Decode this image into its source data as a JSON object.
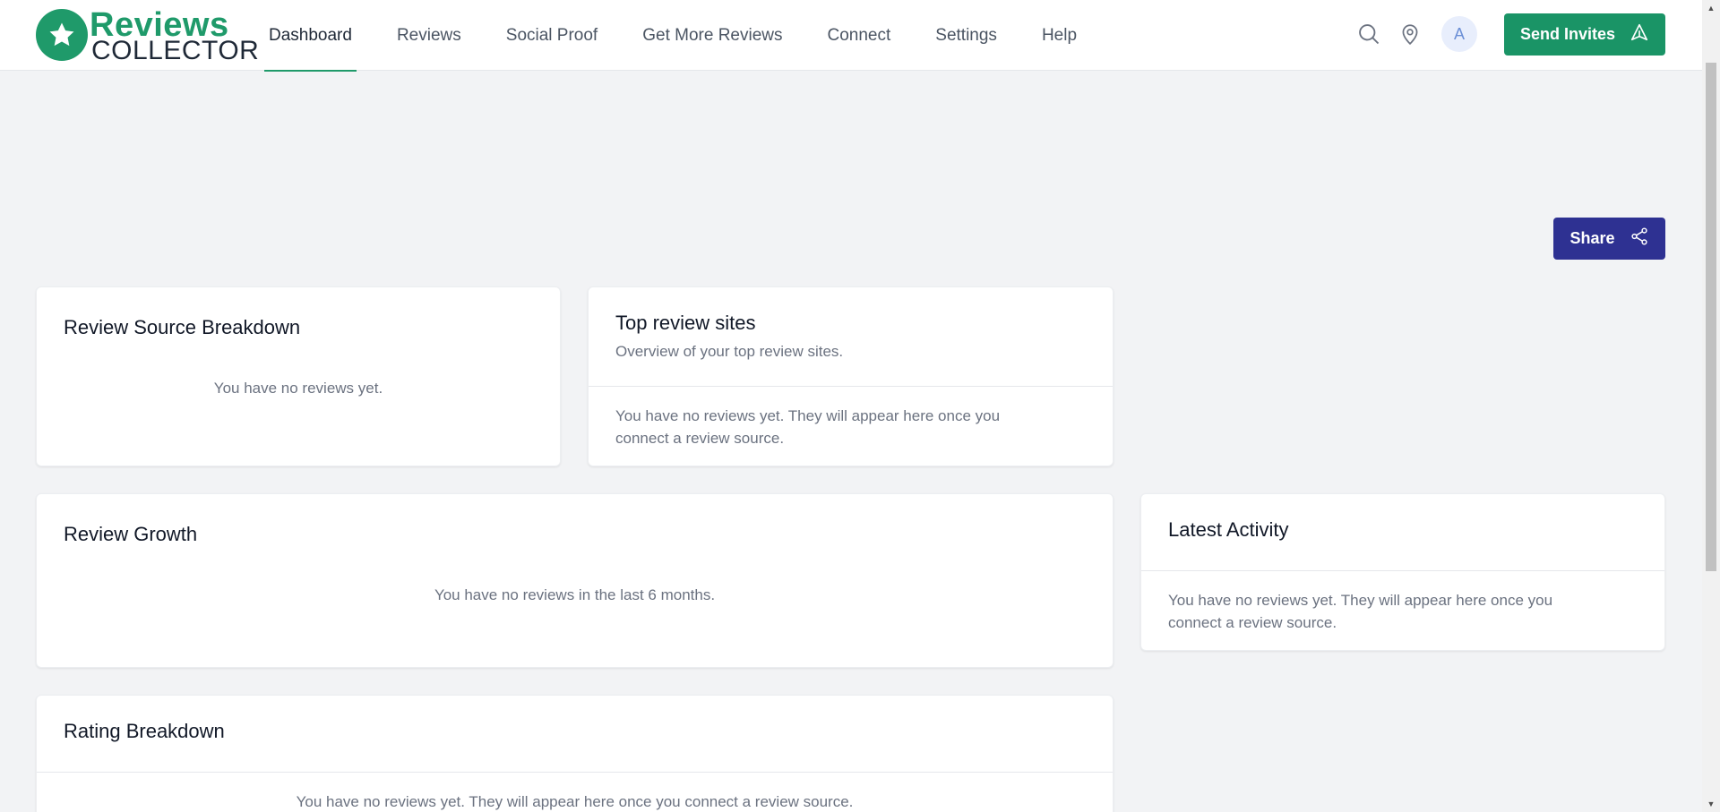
{
  "header": {
    "logo_line1": "Reviews",
    "logo_line2": "COLLECTOR",
    "nav": [
      {
        "label": "Dashboard",
        "active": true
      },
      {
        "label": "Reviews"
      },
      {
        "label": "Social Proof"
      },
      {
        "label": "Get More Reviews"
      },
      {
        "label": "Connect"
      },
      {
        "label": "Settings"
      },
      {
        "label": "Help"
      }
    ],
    "avatar_initial": "A",
    "send_invites_label": "Send Invites",
    "icons": [
      "search-icon",
      "location-pin-icon",
      "send-icon"
    ]
  },
  "toolbar": {
    "share_label": "Share"
  },
  "cards": {
    "review_source": {
      "title": "Review Source Breakdown",
      "empty": "You have no reviews yet."
    },
    "top_sites": {
      "title": "Top review sites",
      "subtitle": "Overview of your top review sites.",
      "empty_line1": "You have no reviews yet. They will appear here once you",
      "empty_line2": "connect a review source."
    },
    "review_growth": {
      "title": "Review Growth",
      "empty": "You have no reviews in the last 6 months."
    },
    "latest_activity": {
      "title": "Latest Activity",
      "empty_line1": "You have no reviews yet. They will appear here once you",
      "empty_line2": "connect a review source."
    },
    "rating_breakdown": {
      "title": "Rating Breakdown",
      "empty": "You have no reviews yet. They will appear here once you connect a review source."
    }
  },
  "colors": {
    "brand_green": "#1a9466",
    "share_blue": "#2e3192",
    "background": "#f2f3f5"
  }
}
